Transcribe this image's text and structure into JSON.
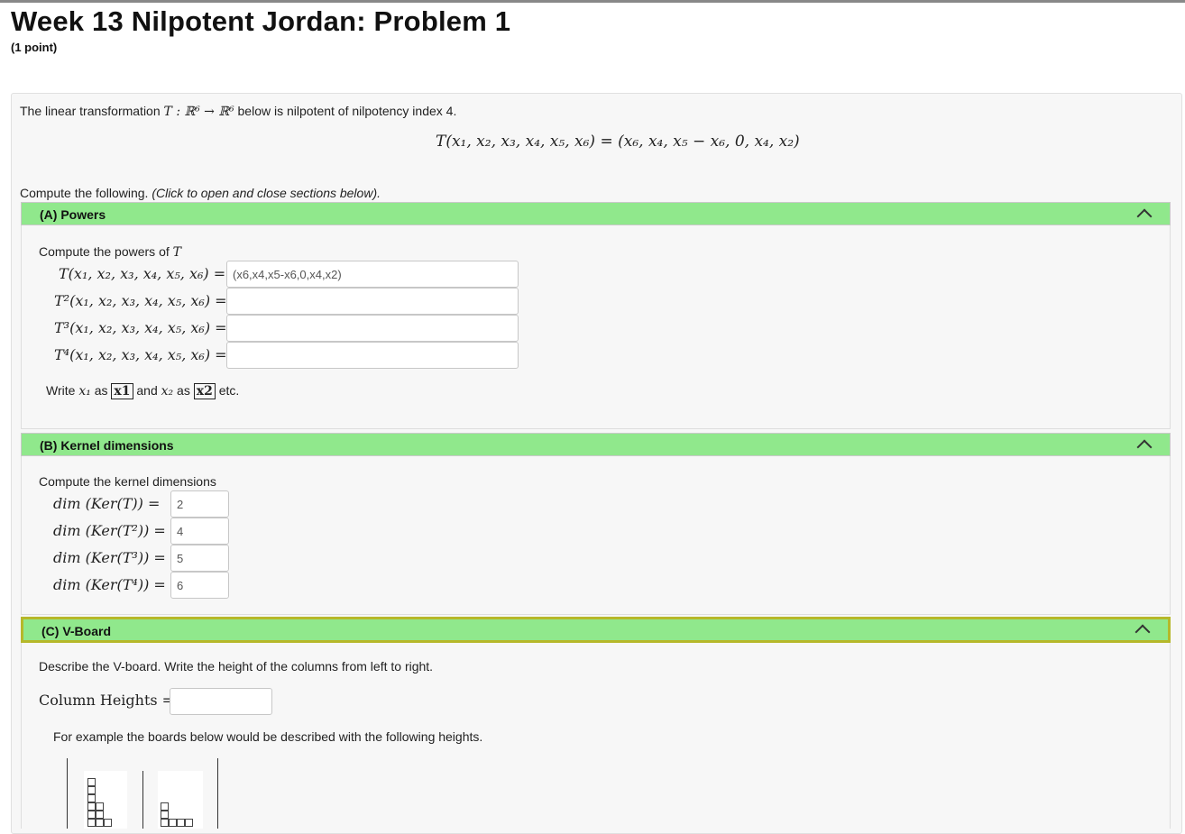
{
  "page": {
    "title": "Week 13 Nilpotent Jordan: Problem 1",
    "points": "(1 point)"
  },
  "problem": {
    "intro_prefix": "The linear transformation ",
    "intro_math": "T : ℝ⁶ → ℝ⁶",
    "intro_suffix": " below is nilpotent of nilpotency index 4.",
    "display_equation": "T(x₁, x₂, x₃, x₄, x₅, x₆) = (x₆, x₄, x₅ − x₆, 0, x₄, x₂)",
    "compute_prefix": "Compute the following. ",
    "compute_hint": "(Click to open and close sections below)."
  },
  "section_a": {
    "header": "(A) Powers",
    "prompt_text": "Compute the powers of ",
    "prompt_math": "T",
    "rows": [
      {
        "label": "T(x₁, x₂, x₃, x₄, x₅, x₆) =",
        "value": "(x6,x4,x5-x6,0,x4,x2)"
      },
      {
        "label": "T²(x₁, x₂, x₃, x₄, x₅, x₆) =",
        "value": ""
      },
      {
        "label": "T³(x₁, x₂, x₃, x₄, x₅, x₆) =",
        "value": ""
      },
      {
        "label": "T⁴(x₁, x₂, x₃, x₄, x₅, x₆) =",
        "value": ""
      }
    ],
    "hint_write": "Write ",
    "hint_x1": "x₁",
    "hint_as1": " as ",
    "hint_box1": "x1",
    "hint_and": " and ",
    "hint_x2": "x₂",
    "hint_as2": " as ",
    "hint_box2": "x2",
    "hint_etc": " etc."
  },
  "section_b": {
    "header": "(B) Kernel dimensions",
    "prompt": "Compute the kernel dimensions",
    "rows": [
      {
        "label": "dim (Ker(T))  =",
        "value": "2"
      },
      {
        "label": "dim (Ker(T²)) =",
        "value": "4"
      },
      {
        "label": "dim (Ker(T³)) =",
        "value": "5"
      },
      {
        "label": "dim (Ker(T⁴)) =",
        "value": "6"
      }
    ]
  },
  "section_c": {
    "header": "(C) V-Board",
    "prompt": "Describe the V-board. Write the height of the columns from left to right.",
    "column_heights_label": "Column Heights =",
    "column_heights_value": "",
    "example_text": "For example the boards below would be described with the following heights."
  },
  "icons": {
    "collapse": "chevron-up-icon"
  },
  "colors": {
    "section_header_bg": "#90e88c",
    "focus_border": "#b6b82a"
  }
}
